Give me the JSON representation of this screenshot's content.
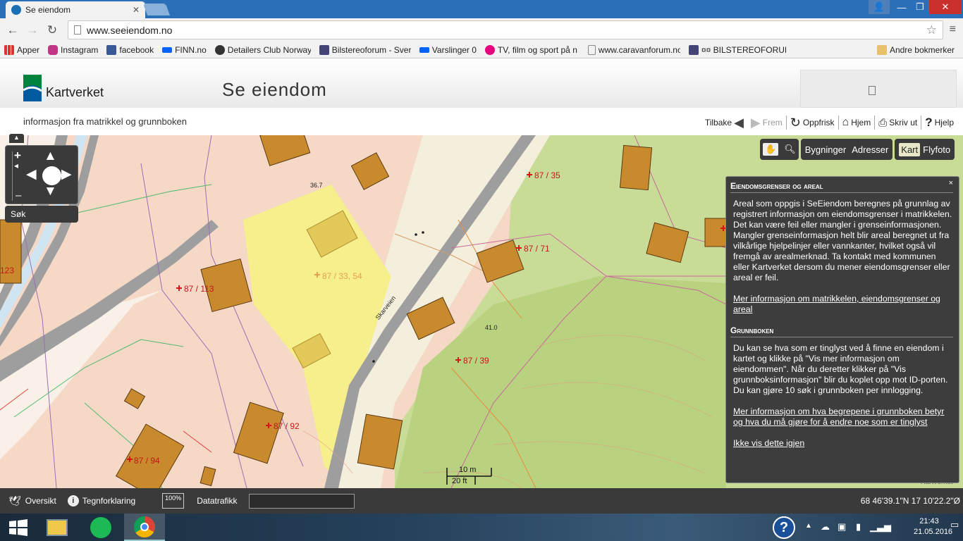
{
  "browser": {
    "tab_title": "Se eiendom",
    "url": "www.seeiendom.no",
    "bookmarks": [
      "Apper",
      "Instagram",
      "facebook",
      "FINN.no",
      "Detailers Club Norway",
      "Bilstereoforum - Sveri",
      "Varslinger 0",
      "TV, film og sport på n",
      "www.caravanforum.no",
      "¤¤ BILSTEREOFORUM",
      "Andre bokmerker"
    ]
  },
  "site": {
    "logo_text": "Kartverket",
    "title": "Se eiendom",
    "subtitle": "informasjon fra matrikkel og grunnboken",
    "toolbar": {
      "back": "Tilbake",
      "forward": "Frem",
      "refresh": "Oppfrisk",
      "home": "Hjem",
      "print": "Skriv ut",
      "help": "Hjelp"
    }
  },
  "map": {
    "search_label": "Søk",
    "layers": {
      "buildings": "Bygninger",
      "addresses": "Adresser",
      "map": "Kart",
      "photo": "Flyfoto"
    },
    "parcels": [
      "87 / 35",
      "87 / 71",
      "87 / 113",
      "87 / 33, 54",
      "87 / 39",
      "87 / 92",
      "87 / 94",
      "123"
    ],
    "heights": [
      "36.7",
      "41.0"
    ],
    "road_name": "Skarveien",
    "scale_m": "10 m",
    "scale_ft": "20 ft",
    "copyright": "Kartverket"
  },
  "info_panel": {
    "close": "×",
    "section1_title": "Eiendomsgrenser og areal",
    "section1_text": "Areal som oppgis i SeEiendom beregnes på grunnlag av registrert informasjon om eiendomsgrenser i matrikkelen. Det kan være feil eller mangler i grenseinformasjonen. Mangler grenseinformasjon helt blir areal beregnet ut fra vilkårlige hjelpelinjer eller vannkanter, hvilket også vil fremgå av arealmerknad. Ta kontakt med kommunen eller Kartverket dersom du mener eiendomsgrenser eller areal er feil.",
    "section1_link": "Mer informasjon om matrikkelen, eiendomsgrenser og areal",
    "section2_title": "Grunnboken",
    "section2_text": "Du kan se hva som er tinglyst ved å finne en eiendom i kartet og klikke på \"Vis mer informasjon om eiendommen\". Når du deretter klikker på \"Vis grunnboksinformasjon\" blir du koplet opp mot ID-porten. Du kan gjøre 10 søk i grunnboken per innlogging.",
    "section2_link": "Mer informasjon om hva begrepene i grunnboken betyr og hva du må gjøre for å endre noe som er tinglyst",
    "dismiss_link": "Ikke vis dette igjen"
  },
  "statusbar": {
    "overview": "Oversikt",
    "legend": "Tegnforklaring",
    "zoom": "100%",
    "datatraffic": "Datatrafikk",
    "coords": "68 46'39.1\"N 17 10'22.2\"Ø"
  },
  "taskbar": {
    "time": "21:43",
    "date": "21.05.2016"
  }
}
